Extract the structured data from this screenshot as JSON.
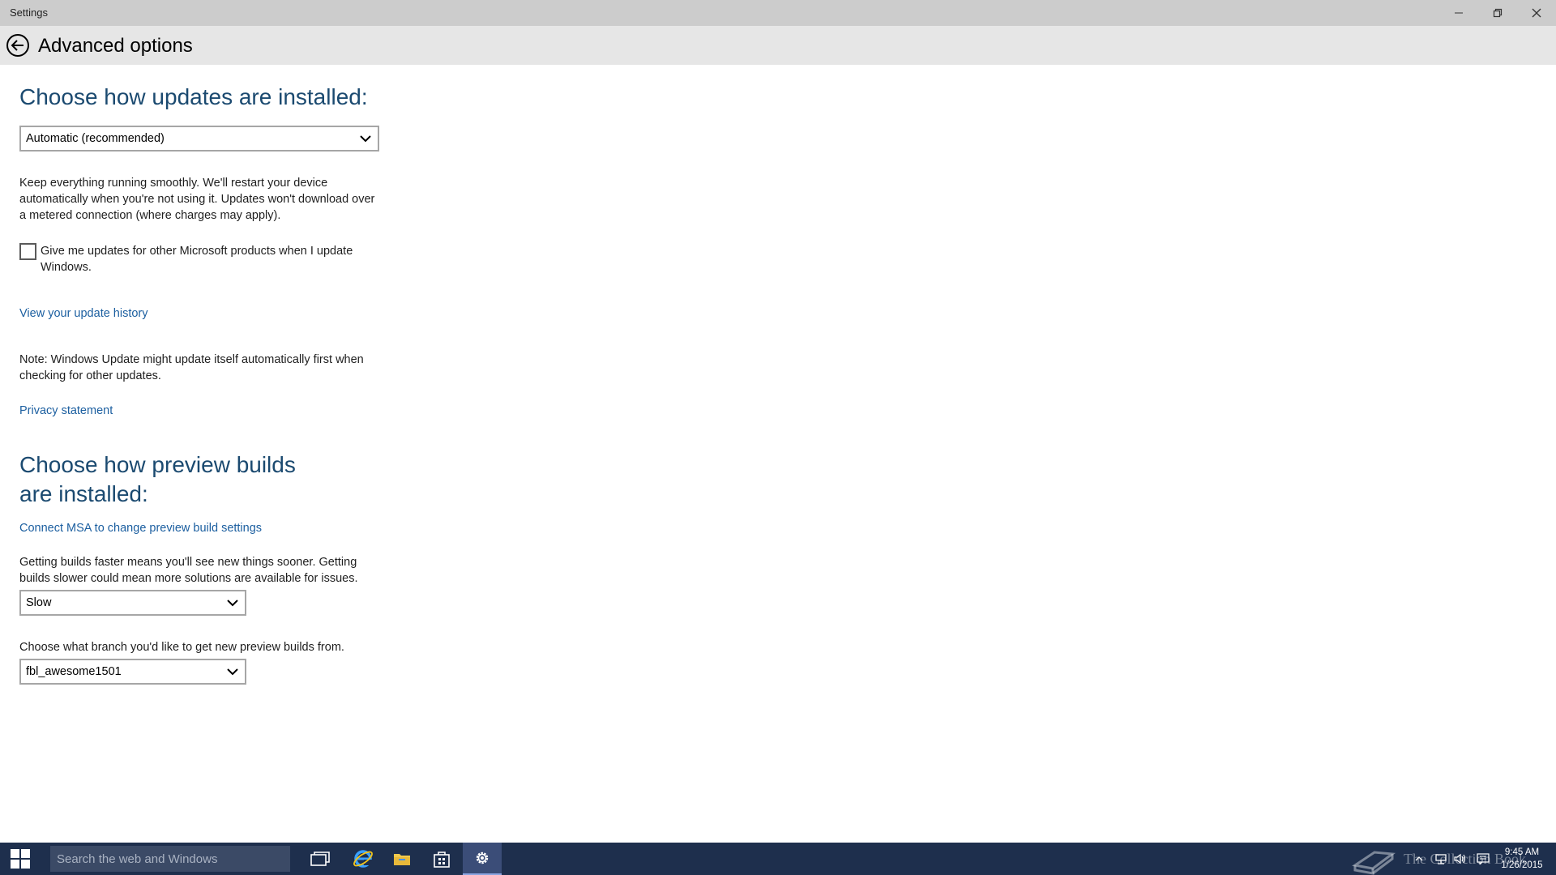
{
  "window": {
    "title": "Settings"
  },
  "header": {
    "title": "Advanced options"
  },
  "updates": {
    "heading": "Choose how updates are installed:",
    "mode_selected": "Automatic (recommended)",
    "description": "Keep everything running smoothly. We'll restart your device automatically when you're not using it. Updates won't download over a metered connection (where charges may apply).",
    "other_products_checkbox": {
      "label": "Give me updates for other Microsoft products when I update Windows.",
      "checked": false
    },
    "history_link": "View your update history",
    "note": "Note: Windows Update might update itself automatically first when checking for other updates.",
    "privacy_link": "Privacy statement"
  },
  "preview": {
    "heading": "Choose how preview builds are installed:",
    "connect_link": "Connect MSA to change preview build settings",
    "speed_description": "Getting builds faster means you'll see new things sooner. Getting builds slower could mean more solutions are available for issues.",
    "speed_selected": "Slow",
    "branch_description": "Choose what branch you'd like to get new preview builds from.",
    "branch_selected": "fbl_awesome1501"
  },
  "taskbar": {
    "search_placeholder": "Search the web and Windows",
    "watermark": "The Collection Book",
    "time": "9:45 AM",
    "date": "1/26/2015",
    "icons": [
      "windows-logo-icon",
      "task-view-icon",
      "internet-explorer-icon",
      "file-explorer-icon",
      "store-icon",
      "settings-gear-icon"
    ],
    "tray_icons": [
      "show-hidden-icons-chevron",
      "network-icon",
      "volume-icon",
      "action-center-icon"
    ]
  },
  "colors": {
    "heading": "#1b4a70",
    "link": "#1c5fa0",
    "taskbar": "#1e2f4d",
    "titlebar": "#cccccc",
    "header": "#e6e6e6"
  }
}
